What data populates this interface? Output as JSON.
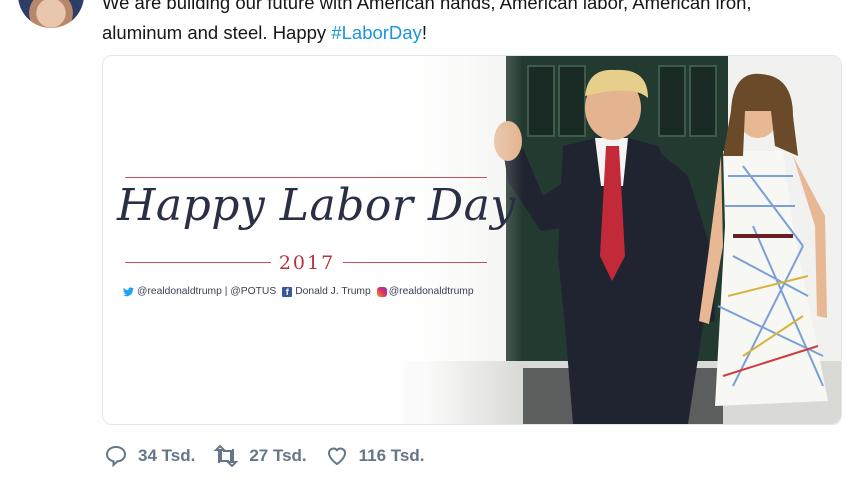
{
  "tweet": {
    "text_line1": "We are building our future with American hands, American labor, American iron,",
    "text_line2_prefix": "aluminum and steel. Happy ",
    "hashtag": "#LaborDay",
    "text_suffix": "!"
  },
  "media": {
    "headline": "Happy Labor Day",
    "year": "2017",
    "socials": {
      "twitter": "@realdonaldtrump | @POTUS",
      "facebook": "Donald J. Trump",
      "instagram": "@realdonaldtrump"
    }
  },
  "actions": {
    "reply_count": "34 Tsd.",
    "retweet_count": "27 Tsd.",
    "like_count": "116 Tsd."
  },
  "colors": {
    "link": "#1b95e0",
    "icon": "#657786",
    "banner_red": "#b8323c",
    "banner_navy": "#2a2f46"
  }
}
